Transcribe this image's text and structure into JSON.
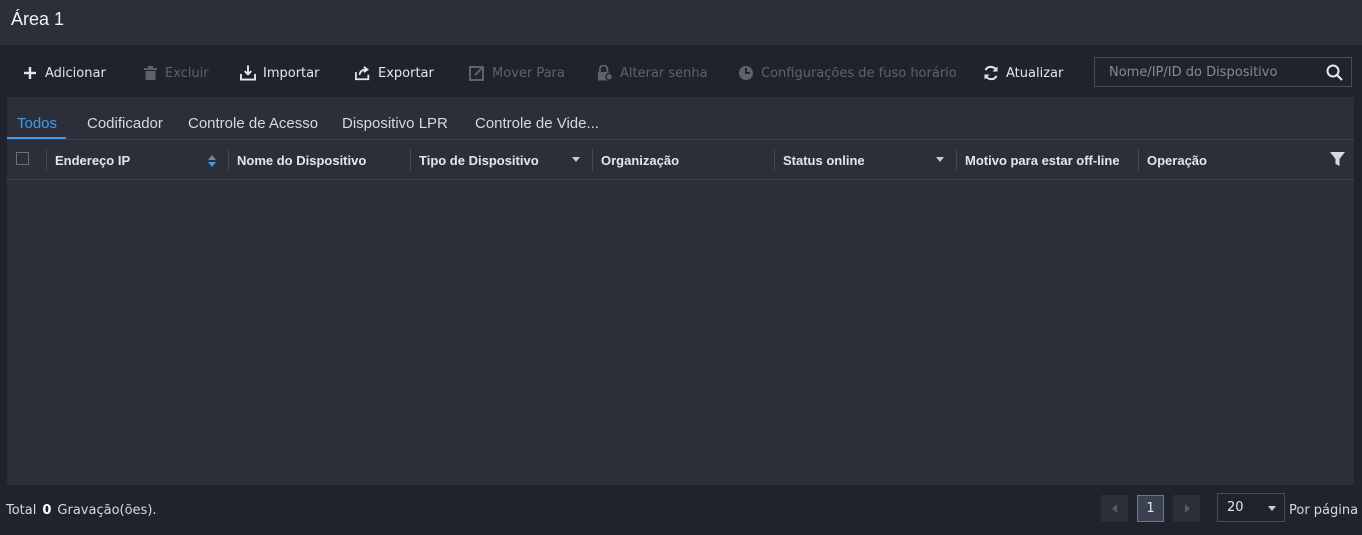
{
  "header": {
    "title": "Área 1"
  },
  "toolbar": {
    "add": "Adicionar",
    "delete": "Excluir",
    "import": "Importar",
    "export": "Exportar",
    "move_to": "Mover Para",
    "change_password": "Alterar senha",
    "timezone_settings": "Configurações de fuso horário",
    "refresh": "Atualizar",
    "search_placeholder": "Nome/IP/ID do Dispositivo",
    "search_value": ""
  },
  "tabs": [
    "Todos",
    "Codificador",
    "Controle de Acesso",
    "Dispositivo LPR",
    "Controle de Vide..."
  ],
  "active_tab": "Todos",
  "table": {
    "columns": [
      "Endereço IP",
      "Nome do Dispositivo",
      "Tipo de Dispositivo",
      "Organização",
      "Status online",
      "Motivo para estar off-line",
      "Operação"
    ],
    "rows": []
  },
  "footer": {
    "total_prefix": "Total",
    "total_count": "0",
    "total_suffix": "Gravação(ões).",
    "current_page": "1",
    "per_page": "20",
    "per_page_label": "Por página"
  },
  "colors": {
    "accent": "#3d9cf0",
    "background": "#20232b",
    "panel": "#2c2f3a"
  }
}
